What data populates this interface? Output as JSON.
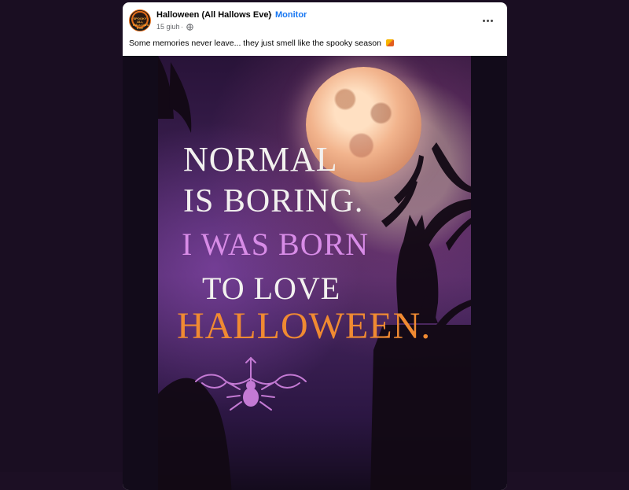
{
  "post": {
    "page_name": "Halloween (All Hallows Eve)",
    "separator": "·",
    "follow_label": "Monitor",
    "date": "15 giuh",
    "meta_dot": "·",
    "caption": "Some memories never leave... they just smell like the spooky season",
    "avatar_text": [
      "SPOOKY",
      "ALL",
      "HALLOWS",
      "EVE"
    ]
  },
  "poster": {
    "lines": [
      "NORMAL",
      "IS BORING.",
      "I WAS BORN",
      "TO LOVE",
      "HALLOWEEN."
    ]
  },
  "icons": {
    "avatar": "halloween-avatar",
    "globe": "globe-icon",
    "more": "more-horizontal-icon",
    "caption_emoji": "fire-leaf-emoji"
  },
  "colors": {
    "page_name": "#050505",
    "follow": "#1877f2",
    "meta": "#65676b",
    "poster_white": "#f2f1ef",
    "poster_purple": "#d88ce7",
    "poster_orange": "#f08a32"
  }
}
